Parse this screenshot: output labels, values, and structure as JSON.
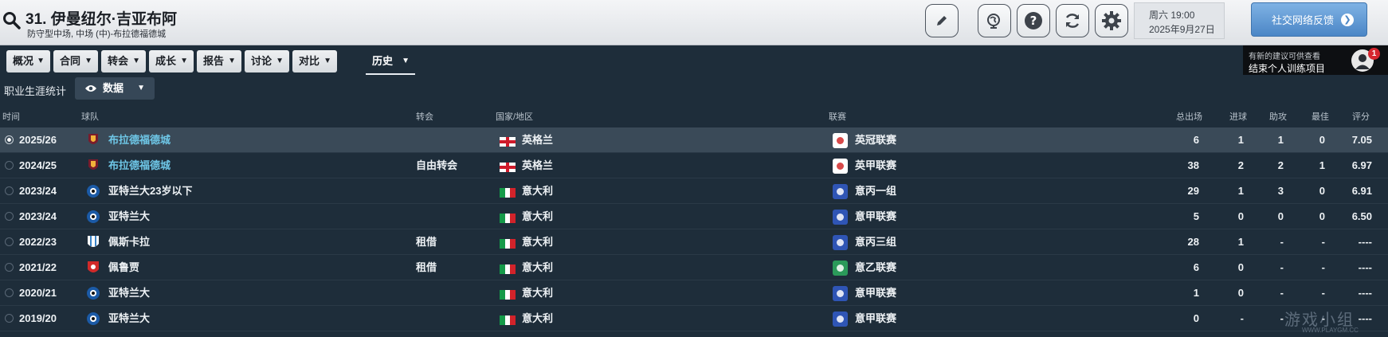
{
  "header": {
    "title": "31. 伊曼纽尔·吉亚布阿",
    "subtitle": "防守型中场, 中场 (中)-布拉德福德城",
    "date_day": "周六 19:00",
    "date": "2025年9月27日",
    "social_button": "社交网络反馈"
  },
  "tabs": [
    {
      "label": "概况"
    },
    {
      "label": "合同"
    },
    {
      "label": "转会"
    },
    {
      "label": "成长"
    },
    {
      "label": "报告"
    },
    {
      "label": "讨论"
    },
    {
      "label": "对比"
    },
    {
      "label": "历史"
    }
  ],
  "notification": {
    "line1": "有新的建议可供查看",
    "line2": "结束个人训练项目",
    "badge": "1"
  },
  "section": {
    "label": "职业生涯统计",
    "dropdown": "数据"
  },
  "columns": {
    "time": "时间",
    "team": "球队",
    "transfer": "转会",
    "nation": "国家/地区",
    "league": "联赛",
    "apps": "总出场",
    "goals": "进球",
    "assists": "助攻",
    "pom": "最佳",
    "rating": "评分"
  },
  "rows": [
    {
      "season": "2025/26",
      "team": "布拉德福德城",
      "transfer": "",
      "nation": "英格兰",
      "league": "英冠联赛",
      "apps": "6",
      "goals": "1",
      "assists": "1",
      "pom": "0",
      "rating": "7.05"
    },
    {
      "season": "2024/25",
      "team": "布拉德福德城",
      "transfer": "自由转会",
      "nation": "英格兰",
      "league": "英甲联赛",
      "apps": "38",
      "goals": "2",
      "assists": "2",
      "pom": "1",
      "rating": "6.97"
    },
    {
      "season": "2023/24",
      "team": "亚特兰大23岁以下",
      "transfer": "",
      "nation": "意大利",
      "league": "意丙一组",
      "apps": "29",
      "goals": "1",
      "assists": "3",
      "pom": "0",
      "rating": "6.91"
    },
    {
      "season": "2023/24",
      "team": "亚特兰大",
      "transfer": "",
      "nation": "意大利",
      "league": "意甲联赛",
      "apps": "5",
      "goals": "0",
      "assists": "0",
      "pom": "0",
      "rating": "6.50"
    },
    {
      "season": "2022/23",
      "team": "佩斯卡拉",
      "transfer": "租借",
      "nation": "意大利",
      "league": "意丙三组",
      "apps": "28",
      "goals": "1",
      "assists": "-",
      "pom": "-",
      "rating": "----"
    },
    {
      "season": "2021/22",
      "team": "佩鲁贾",
      "transfer": "租借",
      "nation": "意大利",
      "league": "意乙联赛",
      "apps": "6",
      "goals": "0",
      "assists": "-",
      "pom": "-",
      "rating": "----"
    },
    {
      "season": "2020/21",
      "team": "亚特兰大",
      "transfer": "",
      "nation": "意大利",
      "league": "意甲联赛",
      "apps": "1",
      "goals": "0",
      "assists": "-",
      "pom": "-",
      "rating": "----"
    },
    {
      "season": "2019/20",
      "team": "亚特兰大",
      "transfer": "",
      "nation": "意大利",
      "league": "意甲联赛",
      "apps": "0",
      "goals": "-",
      "assists": "-",
      "pom": "-",
      "rating": "----"
    }
  ],
  "watermark": {
    "text": "游戏小组",
    "sub": "WWW.PLAYGM.CC"
  },
  "colors": {
    "link": "#6ec6e6",
    "selected_row": "#3a4a58",
    "social_button": "#5b93cf",
    "badge": "#d6262f"
  }
}
